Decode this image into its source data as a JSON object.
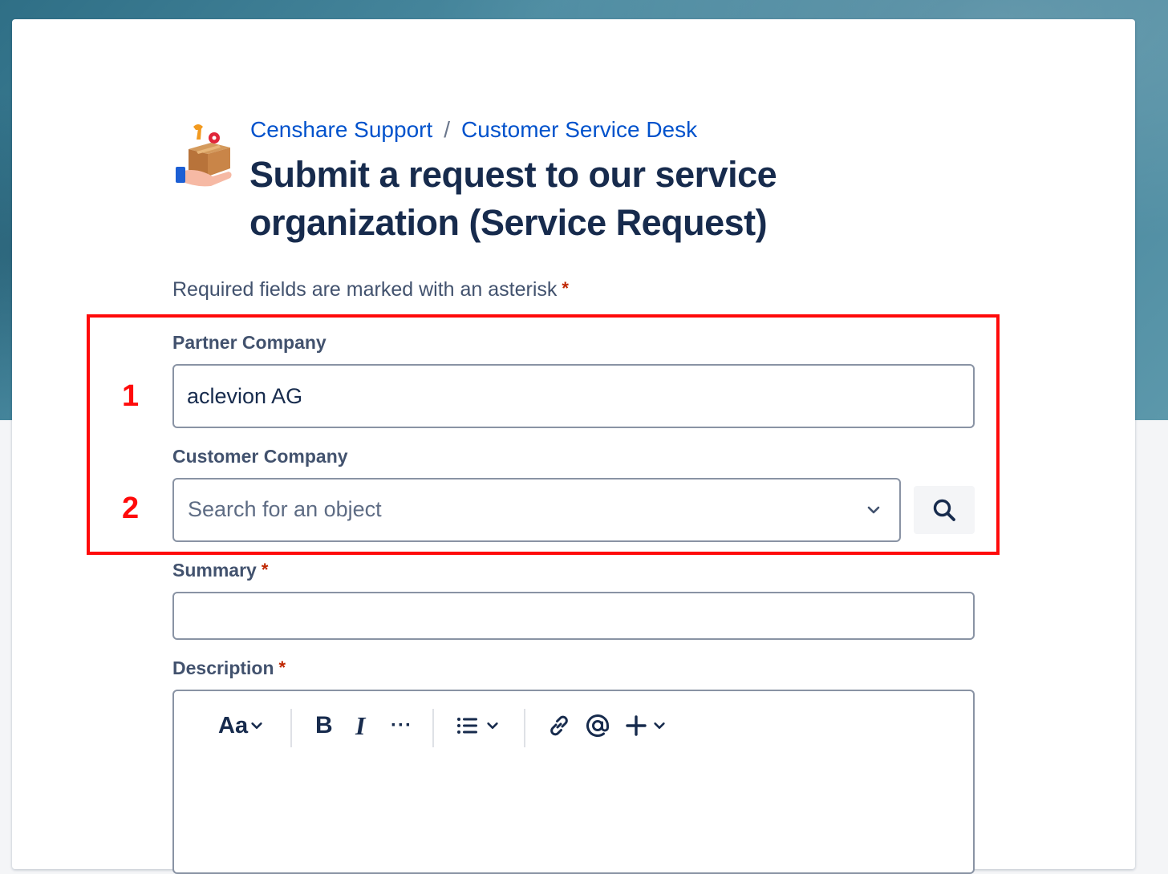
{
  "breadcrumb": {
    "home": "Censhare Support",
    "separator": "/",
    "desk": "Customer Service Desk"
  },
  "page": {
    "title": "Submit a request to our service organization (Service Request)",
    "required_note": "Required fields are marked with an asterisk",
    "asterisk": "*"
  },
  "annotations": {
    "marker_1": "1",
    "marker_2": "2",
    "highlight_color": "#ff0a0a"
  },
  "form": {
    "partner_company": {
      "label": "Partner Company",
      "value": "aclevion AG"
    },
    "customer_company": {
      "label": "Customer Company",
      "placeholder": "Search for an object"
    },
    "summary": {
      "label": "Summary",
      "value": ""
    },
    "description": {
      "label": "Description",
      "toolbar": {
        "text_style": "Aa",
        "bold": "B",
        "italic": "I",
        "more": "···"
      }
    }
  },
  "colors": {
    "link": "#0052cc",
    "title": "#172b4d",
    "required": "#bf2600"
  }
}
